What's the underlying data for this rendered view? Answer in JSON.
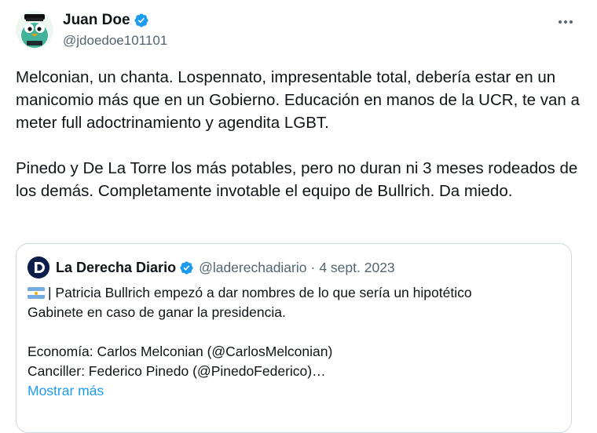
{
  "tweet": {
    "author_name": "Juan Doe",
    "author_handle": "@jdoedoe101101",
    "text": "Melconian, un chanta. Lospennato, impresentable total, debería estar en un manicomio más que en un Gobierno. Educación en manos de la UCR, te van a meter full adoctrinamiento y agendita LGBT.\n\nPinedo y De La Torre los más potables, pero no duran ni 3 meses rodeados de los demás. Completamente invotable el equipo de Bullrich. Da miedo."
  },
  "quote": {
    "author_name": "La Derecha Diario",
    "author_handle": "@laderechadiario",
    "separator": "·",
    "date": "4 sept. 2023",
    "lines": [
      "| Patricia Bullrich empezó a dar nombres de lo que sería un hipotético",
      "Gabinete en caso de ganar la presidencia.",
      "",
      "Economía: Carlos Melconian (@CarlosMelconian)",
      "Canciller: Federico Pinedo (@PinedoFederico)…"
    ],
    "show_more_label": "Mostrar más"
  },
  "colors": {
    "text": "#0f1419",
    "secondary": "#536471",
    "accent": "#1d9bf0",
    "border": "#cfd9de"
  },
  "icons": {
    "verified": "verified-badge-icon",
    "more": "more-options-icon",
    "flag": "argentina-flag-icon"
  }
}
